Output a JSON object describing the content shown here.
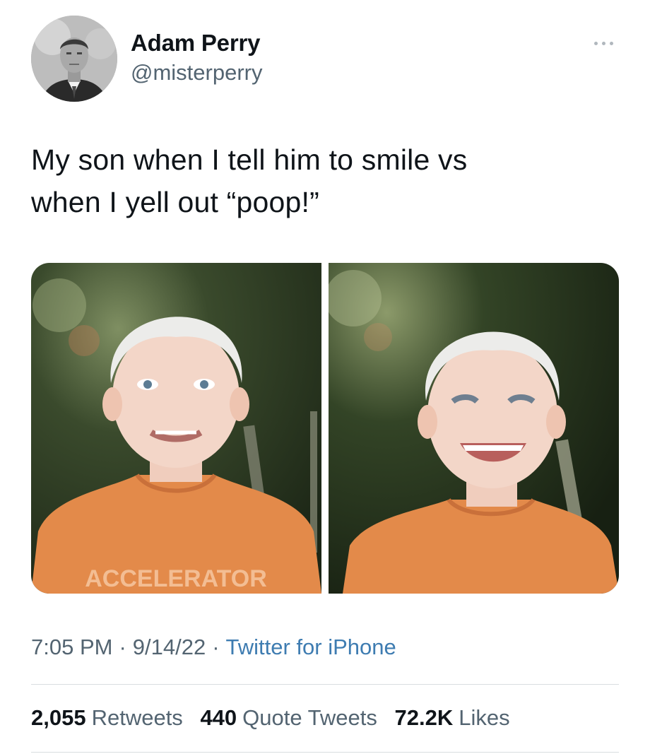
{
  "author": {
    "display_name": "Adam Perry",
    "handle": "@misterperry",
    "avatar_icon": "user-avatar"
  },
  "tweet": {
    "text": "My son when I tell him to smile vs\nwhen I yell out “poop!”",
    "media": [
      {
        "description": "photo-left",
        "shirt_text": "ACCELERATOR"
      },
      {
        "description": "photo-right"
      }
    ]
  },
  "meta": {
    "time": "7:05 PM",
    "separator": "·",
    "date": "9/14/22",
    "source": "Twitter for iPhone"
  },
  "stats": {
    "retweets_count": "2,055",
    "retweets_label": "Retweets",
    "quote_count": "440",
    "quote_label": "Quote Tweets",
    "likes_count": "72.2K",
    "likes_label": "Likes"
  },
  "colors": {
    "link": "#3e7cb1",
    "secondary_text": "#536471",
    "primary_text": "#0f1419",
    "shirt_orange": "#e38a4a"
  }
}
